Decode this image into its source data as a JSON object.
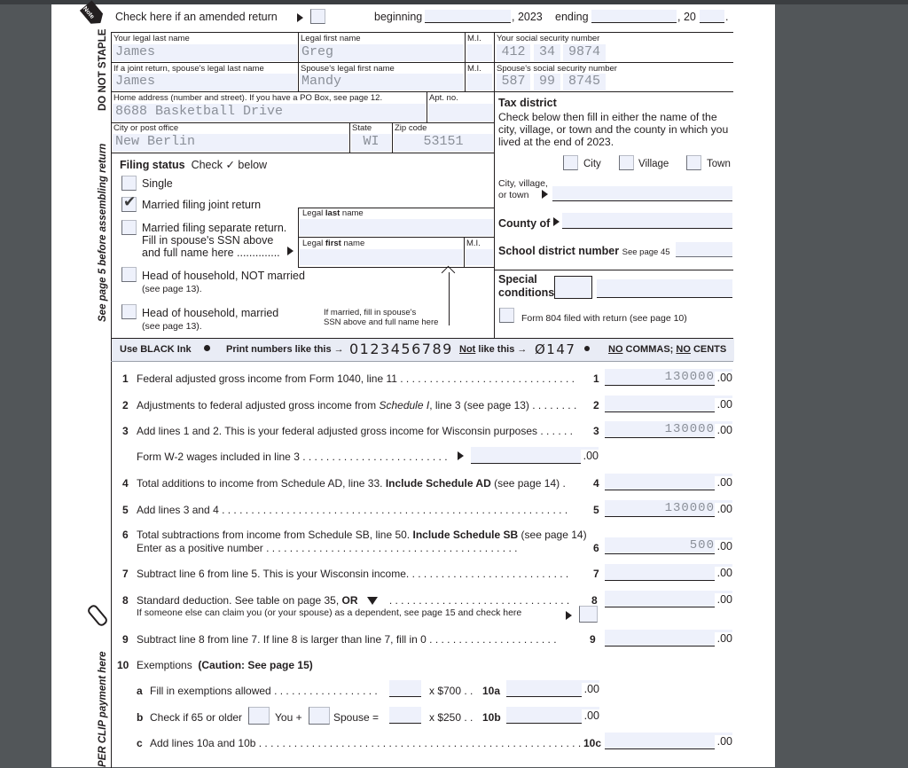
{
  "header": {
    "note_tag": "Note",
    "amended_label": "Check here if an amended return",
    "beginning_label": "beginning",
    "year_label": ", 2023",
    "ending_label": "ending",
    "ending_year_prefix": ", 20",
    "period": "."
  },
  "margin": {
    "do_not_staple": "DO NOT STAPLE",
    "see_page": "See page 5 before assembling return",
    "paper_clip": "PER CLIP payment here"
  },
  "identity": {
    "your_last_name_label": "Your legal last name",
    "your_last_name": "James",
    "your_first_name_label": "Legal first name",
    "your_first_name": "Greg",
    "mi_label": "M.I.",
    "your_ssn_label": "Your social security number",
    "your_ssn": [
      "412",
      "34",
      "9874"
    ],
    "spouse_last_name_label": "If a joint return, spouse's legal last name",
    "spouse_last_name": "James",
    "spouse_first_name_label": "Spouse's legal first name",
    "spouse_first_name": "Mandy",
    "spouse_mi_label": "M.I.",
    "spouse_ssn_label": "Spouse's social security number",
    "spouse_ssn": [
      "587",
      "99",
      "8745"
    ],
    "address_label": "Home address (number and street). If you have a PO Box, see page 12.",
    "address": "8688 Basketball Drive",
    "apt_label": "Apt. no.",
    "city_label": "City or post office",
    "city": "New Berlin",
    "state_label": "State",
    "state": "WI",
    "zip_label": "Zip code",
    "zip": "53151"
  },
  "filing_status": {
    "title": "Filing status",
    "instruction": "Check ✓ below",
    "options": [
      {
        "label": "Single",
        "checked": false
      },
      {
        "label": "Married filing joint return",
        "checked": true
      },
      {
        "label": "Married filing separate return.",
        "line2": "Fill in spouse's SSN above",
        "line3": "and full name here ..............",
        "checked": false
      },
      {
        "label": "Head of household, NOT married",
        "line2": "(see page 13).",
        "checked": false
      },
      {
        "label": "Head of household, married",
        "line2": "(see page 13).",
        "checked": false
      }
    ],
    "sep_last_label_pre": "Legal ",
    "sep_last_label_bold": "last",
    "sep_last_label_post": " name",
    "sep_first_label_pre": "Legal ",
    "sep_first_label_bold": "first",
    "sep_first_label_post": " name",
    "sep_mi_label": "M.I.",
    "married_note_1": "If married, fill in spouse's",
    "married_note_2": "SSN above and full name here"
  },
  "tax_district": {
    "title": "Tax district",
    "desc_1": "Check below then fill in either the name of the",
    "desc_2": "city, village, or town and the county in which you",
    "desc_3": "lived at the end of 2023.",
    "city_opt": "City",
    "village_opt": "Village",
    "town_opt": "Town",
    "cvt_label_1": "City, village,",
    "cvt_label_2": "or town",
    "county_label": "County of",
    "school_label": "School district number",
    "school_see": "See page 45",
    "special_1": "Special",
    "special_2": "conditions",
    "form804": "Form 804 filed with return (see page 10)"
  },
  "ink_bar": {
    "use_black": "Use BLACK Ink",
    "print_like": "Print numbers like this →",
    "good_digits": "0123456789",
    "not_word": "Not",
    "not_like": " like this →",
    "bad_digits": "Ø147",
    "no1": "NO",
    "commas": " COMMAS; ",
    "no2": "NO",
    "cents": " CENTS"
  },
  "cents_suffix": ".00",
  "lines": [
    {
      "num": "1",
      "text": "Federal adjusted gross income from Form 1040, line 11 . . . . . . . . . . . . . . . . . . . . . . . . . . . . . .",
      "ref": "1",
      "value": "130000"
    },
    {
      "num": "2",
      "text_pre": "Adjustments to federal adjusted gross income from ",
      "text_italic": "Schedule I",
      "text_post": ", line 3 (see page 13) . . . . . . . .",
      "ref": "2",
      "value": ""
    },
    {
      "num": "3",
      "text": "Add lines 1 and 2. This is your federal adjusted gross income for Wisconsin purposes . . . . . .",
      "ref": "3",
      "value": "130000"
    },
    {
      "num": "",
      "text": "Form W-2 wages included in line 3 . . . . . . . . . . . . . . . . . . . . . . . . .",
      "ref": "",
      "value": ""
    },
    {
      "num": "4",
      "text_pre": "Total additions to income from Schedule AD, line 33. ",
      "text_bold": "Include Schedule AD",
      "text_post": " (see page 14)  .",
      "ref": "4",
      "value": ""
    },
    {
      "num": "5",
      "text": "Add lines 3 and 4 . . . . . . . . . . . . . . . . . . . . . . . . . . . . . . . . . . . . . . . . . . . . . . . . . . . . . . . . . . .",
      "ref": "5",
      "value": "130000"
    },
    {
      "num": "6",
      "text_pre": "Total subtractions from income from Schedule SB, line 50. ",
      "text_bold": "Include Schedule SB",
      "text_post": " (see page 14)",
      "text_line2": "Enter as a positive number  . . . . . . . . . . . . . . . . . . . . . . . . . . . . . . . . . . . . . . . . . . .",
      "ref": "6",
      "value": "500"
    },
    {
      "num": "7",
      "text": "Subtract line 6 from line 5. This is your Wisconsin income. . . . . . . . . . . . . . . . . . . . . . . . . . . .",
      "ref": "7",
      "value": ""
    },
    {
      "num": "8",
      "text_pre": "Standard deduction.  See table on page 35, ",
      "text_bold": "OR",
      "text_post": " . . . . . . . . . . . . . . . . . . . . . . . . . . . . . . .",
      "text_line2": "If someone else can claim you (or your spouse) as a dependent, see page 15 and check here",
      "ref": "8",
      "value": ""
    },
    {
      "num": "9",
      "text": "Subtract line 8 from line 7. If line 8 is larger than line 7, fill in 0 . . . . . . . . . . . . . . . . . . . . . .",
      "ref": "9",
      "value": ""
    }
  ],
  "exemptions": {
    "num": "10",
    "title": "Exemptions",
    "caution": "(Caution:  See page 15)",
    "a_letter": "a",
    "a_text": "Fill in exemptions allowed  . . . . . . . . . . . . . . . . . .",
    "a_mult": "x $700 . .",
    "a_ref": "10a",
    "b_letter": "b",
    "b_text": "Check if 65 or older",
    "b_you": "You  +",
    "b_spouse": "Spouse  =",
    "b_mult": "x $250 . .",
    "b_ref": "10b",
    "c_letter": "c",
    "c_text": "Add lines 10a and 10b  . . . . . . . . . . . . . . . . . . . . . . . . . . . . . . . . . . . . . . . . . . . . . . . . . . . . . . . .",
    "c_ref": "10c"
  }
}
